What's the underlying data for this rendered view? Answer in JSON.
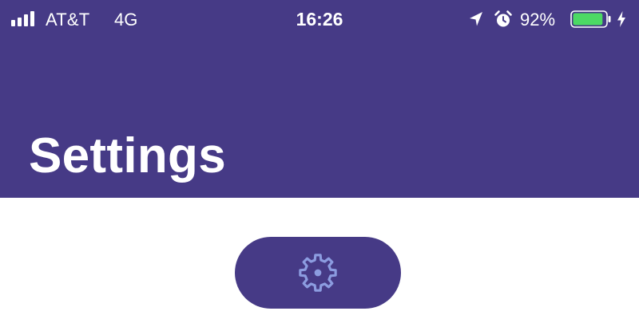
{
  "status_bar": {
    "carrier": "AT&T",
    "network": "4G",
    "time": "16:26",
    "battery_percent": "92%",
    "battery_level": 0.92,
    "icons": [
      "signal-bars-icon",
      "location-arrow-icon",
      "alarm-clock-icon",
      "battery-icon",
      "charging-bolt-icon"
    ]
  },
  "header": {
    "title": "Settings"
  },
  "main": {
    "settings_button": {
      "icon": "gear-icon"
    }
  },
  "colors": {
    "header_background": "#463A86",
    "button_background": "#463A86",
    "gear_icon": "#8C9CE0",
    "battery_fill": "#4CD964",
    "background": "#FFFFFF",
    "text": "#FFFFFF"
  }
}
